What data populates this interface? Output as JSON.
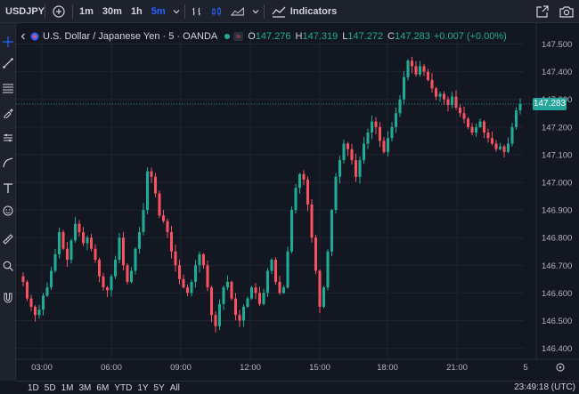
{
  "toolbar": {
    "symbol": "USDJPY",
    "intervals": [
      "1m",
      "30m",
      "1h",
      "5m"
    ],
    "active_interval": "5m",
    "indicators_label": "Indicators"
  },
  "legend": {
    "title": "U.S. Dollar / Japanese Yen · 5 · OANDA",
    "tag": "≈",
    "open_key": "O",
    "open": "147.276",
    "high_key": "H",
    "high": "147.319",
    "low_key": "L",
    "low": "147.272",
    "close_key": "C",
    "close": "147.283",
    "change": "+0.007 (+0.00%)"
  },
  "colors": {
    "up": "#22ab94",
    "down": "#f7525f",
    "background": "#131722",
    "accent": "#2962ff"
  },
  "current_price": "147.283",
  "bottom": {
    "ranges": [
      "1D",
      "5D",
      "1M",
      "3M",
      "6M",
      "YTD",
      "1Y",
      "5Y",
      "All"
    ],
    "clock": "23:49:18 (UTC)"
  },
  "chart_data": {
    "type": "candlestick",
    "title": "U.S. Dollar / Japanese Yen · 5 · OANDA",
    "x_ticks": [
      "03:00",
      "06:00",
      "09:00",
      "12:00",
      "15:00",
      "18:00",
      "21:00",
      "5"
    ],
    "y_ticks": [
      "147.500",
      "147.400",
      "147.300",
      "147.200",
      "147.100",
      "147.000",
      "146.900",
      "146.800",
      "146.700",
      "146.600",
      "146.500",
      "146.400"
    ],
    "ylim": [
      146.36,
      147.55
    ],
    "grid": true,
    "last_price": 147.283,
    "series": [
      {
        "close": [
          146.64,
          146.58,
          146.55,
          146.52,
          146.54,
          146.59,
          146.62,
          146.68,
          146.74,
          146.82,
          146.76,
          146.72,
          146.79,
          146.85,
          146.82,
          146.78,
          146.8,
          146.76,
          146.72,
          146.66,
          146.62,
          146.61,
          146.66,
          146.72,
          146.8,
          146.7,
          146.64,
          146.68,
          146.76,
          146.82,
          146.9,
          147.04,
          147.02,
          146.96,
          146.88,
          146.86,
          146.82,
          146.75,
          146.7,
          146.65,
          146.62,
          146.6,
          146.64,
          146.7,
          146.74,
          146.7,
          146.62,
          146.52,
          146.48,
          146.56,
          146.62,
          146.64,
          146.58,
          146.52,
          146.5,
          146.55,
          146.58,
          146.62,
          146.6,
          146.56,
          146.6,
          146.68,
          146.72,
          146.64,
          146.6,
          146.62,
          146.75,
          146.9,
          146.98,
          147.03,
          147.01,
          146.92,
          146.8,
          146.68,
          146.55,
          146.62,
          146.75,
          146.9,
          147.02,
          147.08,
          147.14,
          147.12,
          147.08,
          147.02,
          147.08,
          147.14,
          147.18,
          147.22,
          147.2,
          147.15,
          147.11,
          147.16,
          147.2,
          147.25,
          147.3,
          147.38,
          147.44,
          147.42,
          147.39,
          147.42,
          147.4,
          147.37,
          147.34,
          147.31,
          147.32,
          147.3,
          147.28,
          147.31,
          147.27,
          147.25,
          147.23,
          147.2,
          147.18,
          147.2,
          147.22,
          147.18,
          147.16,
          147.14,
          147.12,
          147.13,
          147.11,
          147.14,
          147.2,
          147.26,
          147.283
        ]
      }
    ]
  }
}
